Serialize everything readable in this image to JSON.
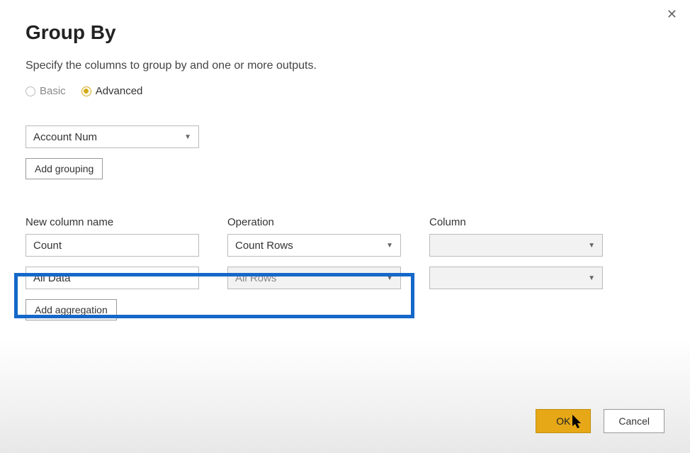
{
  "dialog": {
    "title": "Group By",
    "description": "Specify the columns to group by and one or more outputs.",
    "mode": {
      "basic_label": "Basic",
      "advanced_label": "Advanced",
      "selected": "Advanced"
    },
    "grouping": {
      "column_value": "Account Num",
      "add_button": "Add grouping"
    },
    "aggregation_headers": {
      "new_column": "New column name",
      "operation": "Operation",
      "column": "Column"
    },
    "aggregations": [
      {
        "name": "Count",
        "operation": "Count Rows",
        "column": "",
        "col_disabled": true
      },
      {
        "name": "All Data",
        "operation": "All Rows",
        "column": "",
        "col_disabled": true,
        "op_disabled_look": true
      }
    ],
    "add_agg_button": "Add aggregation",
    "buttons": {
      "ok": "OK",
      "cancel": "Cancel"
    }
  }
}
